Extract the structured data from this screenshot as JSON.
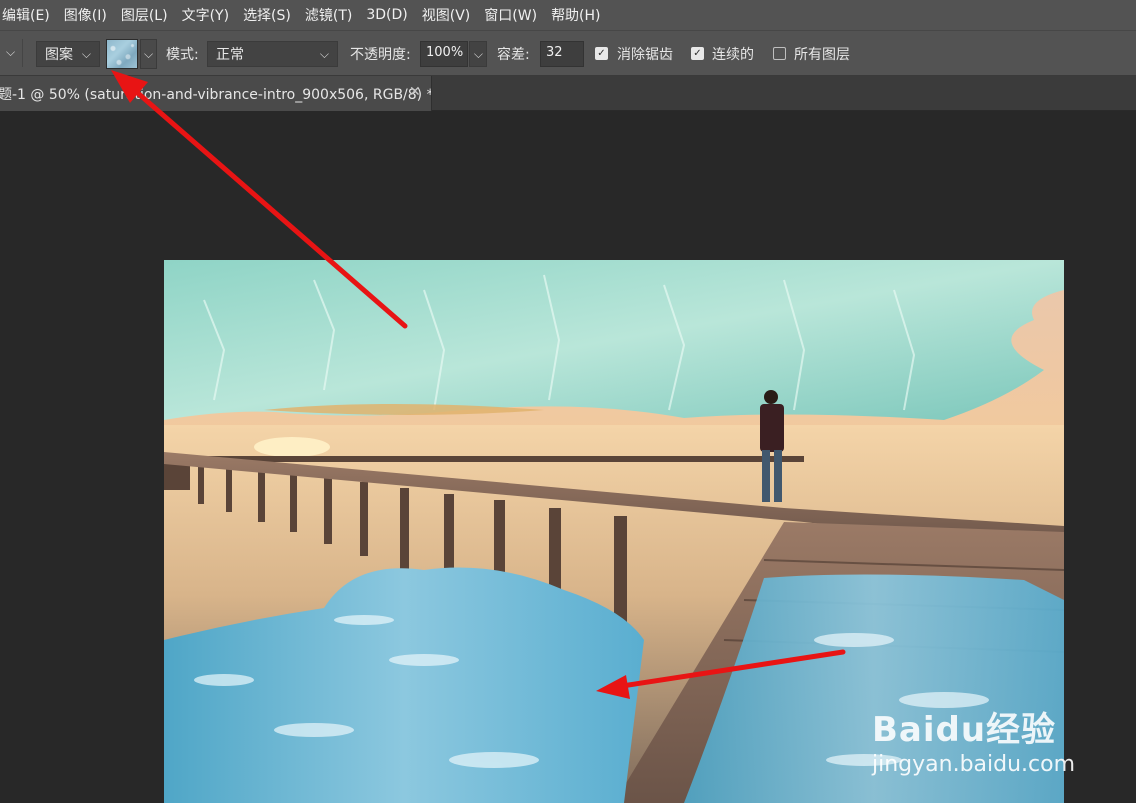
{
  "menu": [
    "编辑(E)",
    "图像(I)",
    "图层(L)",
    "文字(Y)",
    "选择(S)",
    "滤镜(T)",
    "3D(D)",
    "视图(V)",
    "窗口(W)",
    "帮助(H)"
  ],
  "options": {
    "fill_source": "图案",
    "mode_label": "模式:",
    "mode_value": "正常",
    "opacity_label": "不透明度:",
    "opacity_value": "100%",
    "tolerance_label": "容差:",
    "tolerance_value": "32",
    "anti_alias_label": "消除锯齿",
    "anti_alias_checked": true,
    "contiguous_label": "连续的",
    "contiguous_checked": true,
    "all_layers_label": "所有图层",
    "all_layers_checked": false
  },
  "document_tab": {
    "title": "题-1 @ 50% (saturation-and-vibrance-intro_900x506, RGB/8) *"
  },
  "watermark": {
    "logo": "Baidu经验",
    "url": "jingyan.baidu.com"
  },
  "colors": {
    "arrow": "#e81414",
    "workspace": "#282828",
    "chrome": "#535353"
  }
}
